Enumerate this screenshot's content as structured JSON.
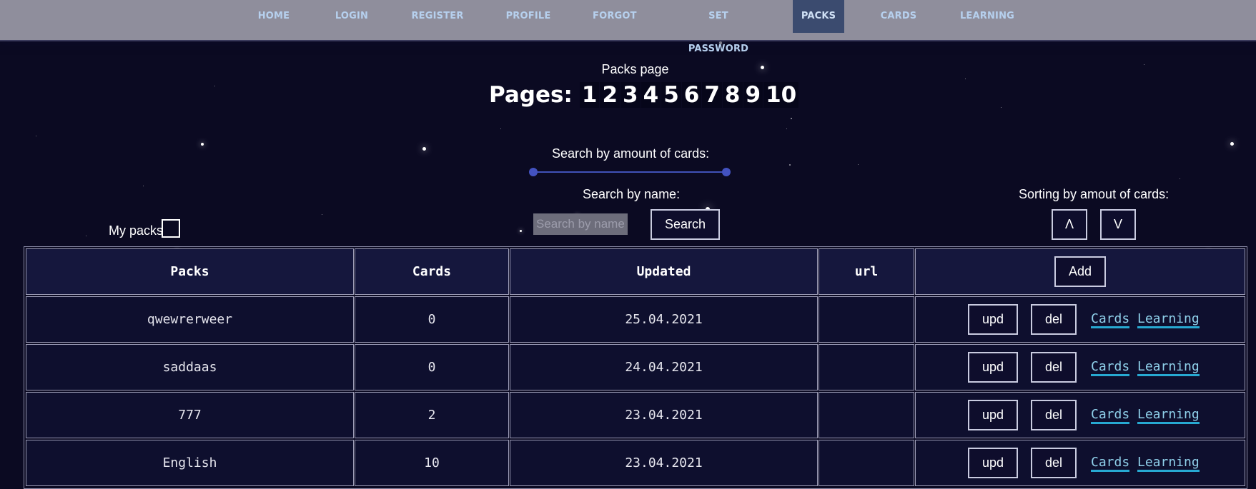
{
  "nav": {
    "items": [
      {
        "label": "HOME"
      },
      {
        "label": "LOGIN"
      },
      {
        "label": "REGISTER"
      },
      {
        "label": "PROFILE"
      },
      {
        "label": "FORGOT"
      },
      {
        "label": "SET PASSWORD"
      },
      {
        "label": "PACKS",
        "active": true
      },
      {
        "label": "CARDS"
      },
      {
        "label": "LEARNING"
      }
    ]
  },
  "page": {
    "title": "Packs page",
    "pages_label": "Pages:",
    "pages": [
      "1",
      "2",
      "3",
      "4",
      "5",
      "6",
      "7",
      "8",
      "9",
      "10"
    ]
  },
  "filters": {
    "amount_label": "Search by amount of cards:",
    "name_label": "Search by name:",
    "name_placeholder": "Search by name",
    "search_button": "Search",
    "my_packs_label": "My packs",
    "sorting_label": "Sorting by amout of cards:",
    "sort_up": "Λ",
    "sort_down": "V"
  },
  "table": {
    "headers": [
      "Packs",
      "Cards",
      "Updated",
      "url"
    ],
    "add_button": "Add",
    "upd_label": "upd",
    "del_label": "del",
    "cards_link": "Cards",
    "learning_link": "Learning",
    "rows": [
      {
        "name": "qwewrerweer",
        "cards": "0",
        "updated": "25.04.2021",
        "url": ""
      },
      {
        "name": "saddaas",
        "cards": "0",
        "updated": "24.04.2021",
        "url": ""
      },
      {
        "name": "777",
        "cards": "2",
        "updated": "23.04.2021",
        "url": ""
      },
      {
        "name": "English",
        "cards": "10",
        "updated": "23.04.2021",
        "url": ""
      }
    ]
  },
  "colors": {
    "background": "#0b0a22",
    "nav": "#8f8e9c",
    "nav_active": "#3b4b6f",
    "link": "#8fd0ea",
    "slider": "#4152b8"
  }
}
